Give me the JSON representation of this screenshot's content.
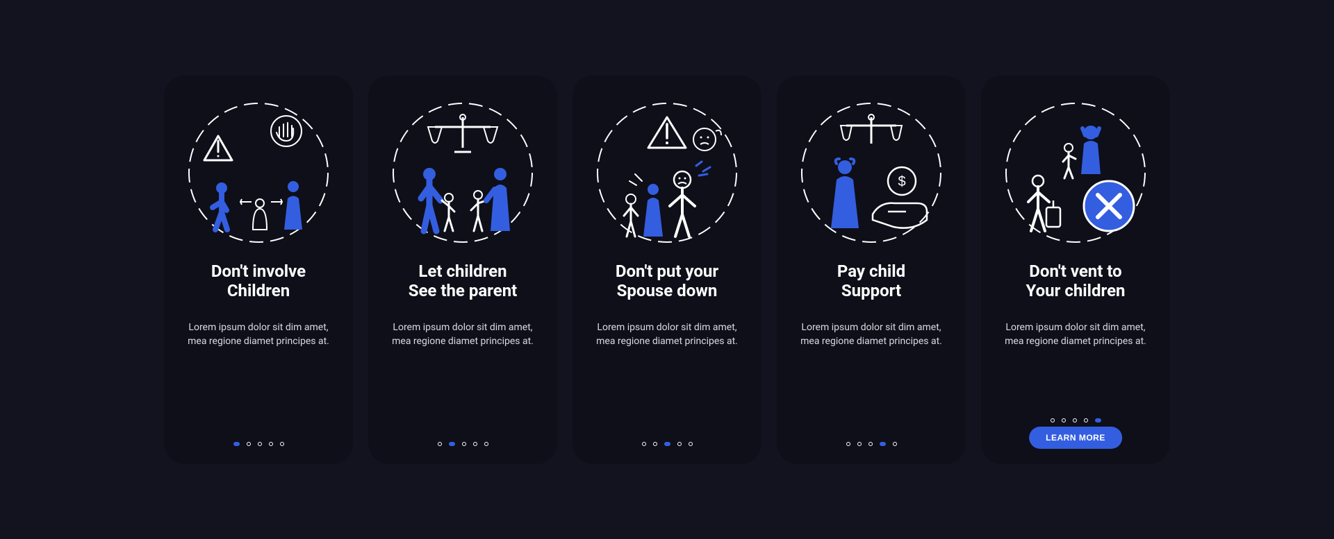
{
  "accent": "#345ee0",
  "cards": [
    {
      "icon": "dont-involve-children-icon",
      "title_line1": "Don't involve",
      "title_line2": "Children",
      "body": "Lorem ipsum dolor sit dim amet, mea regione diamet principes at.",
      "activeIndex": 0,
      "button_label": ""
    },
    {
      "icon": "let-children-see-parent-icon",
      "title_line1": "Let children",
      "title_line2": "See the parent",
      "body": "Lorem ipsum dolor sit dim amet, mea regione diamet principes at.",
      "activeIndex": 1,
      "button_label": ""
    },
    {
      "icon": "dont-put-spouse-down-icon",
      "title_line1": "Don't put your",
      "title_line2": "Spouse down",
      "body": "Lorem ipsum dolor sit dim amet, mea regione diamet principes at.",
      "activeIndex": 2,
      "button_label": ""
    },
    {
      "icon": "pay-child-support-icon",
      "title_line1": "Pay child",
      "title_line2": "Support",
      "body": "Lorem ipsum dolor sit dim amet, mea regione diamet principes at.",
      "activeIndex": 3,
      "button_label": ""
    },
    {
      "icon": "dont-vent-to-children-icon",
      "title_line1": "Don't vent to",
      "title_line2": "Your children",
      "body": "Lorem ipsum dolor sit dim amet, mea regione diamet principes at.",
      "activeIndex": 4,
      "button_label": "LEARN MORE"
    }
  ]
}
